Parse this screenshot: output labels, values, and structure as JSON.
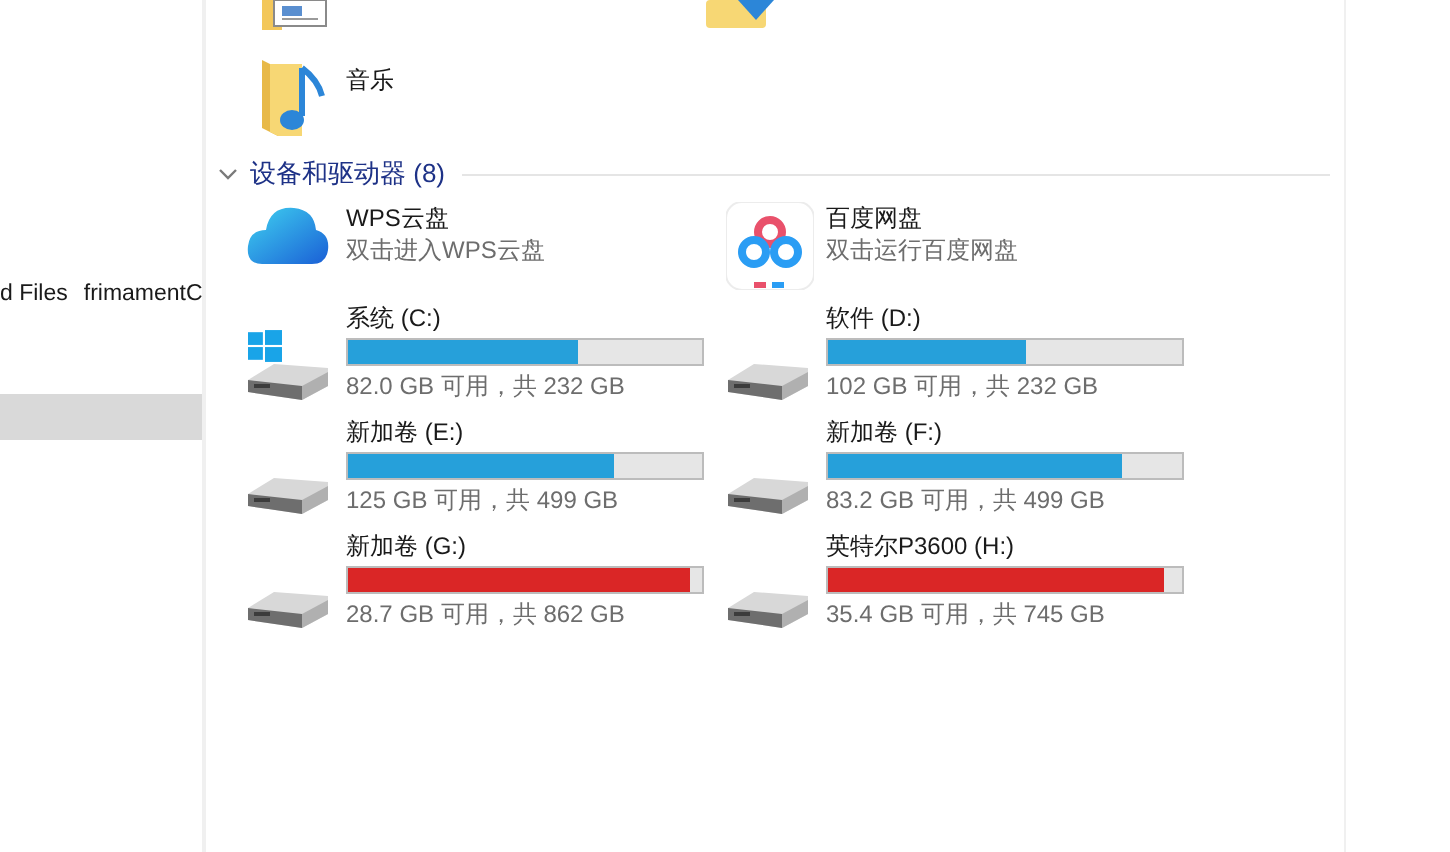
{
  "sidebar": {
    "rows": [
      {
        "column_1": "d Files",
        "column_2": "frimamentC",
        "selected": false
      },
      {
        "selected": true
      }
    ]
  },
  "top_icons": [
    {
      "kind": "document"
    },
    {
      "kind": "download"
    }
  ],
  "folders": [
    {
      "label": "音乐",
      "kind": "music"
    }
  ],
  "section": {
    "title": "设备和驱动器 (8)",
    "expanded": true,
    "items": [
      {
        "kind": "wps",
        "name": "WPS云盘",
        "detail": "双击进入WPS云盘"
      },
      {
        "kind": "baidu",
        "name": "百度网盘",
        "detail": "双击运行百度网盘"
      },
      {
        "kind": "system_drive",
        "name": "系统 (C:)",
        "level": 0.65,
        "low_space": false,
        "detail": "82.0 GB 可用，共 232 GB"
      },
      {
        "kind": "drive",
        "name": "软件 (D:)",
        "level": 0.56,
        "low_space": false,
        "detail": "102 GB 可用，共 232 GB"
      },
      {
        "kind": "drive",
        "name": "新加卷 (E:)",
        "level": 0.75,
        "low_space": false,
        "detail": "125 GB 可用，共 499 GB"
      },
      {
        "kind": "drive",
        "name": "新加卷 (F:)",
        "level": 0.83,
        "low_space": false,
        "detail": "83.2 GB 可用，共 499 GB"
      },
      {
        "kind": "drive",
        "name": "新加卷 (G:)",
        "level": 0.967,
        "low_space": true,
        "detail": "28.7 GB 可用，共 862 GB"
      },
      {
        "kind": "drive",
        "name": "英特尔P3600 (H:)",
        "level": 0.95,
        "low_space": true,
        "detail": "35.4 GB 可用，共 745 GB"
      }
    ]
  }
}
